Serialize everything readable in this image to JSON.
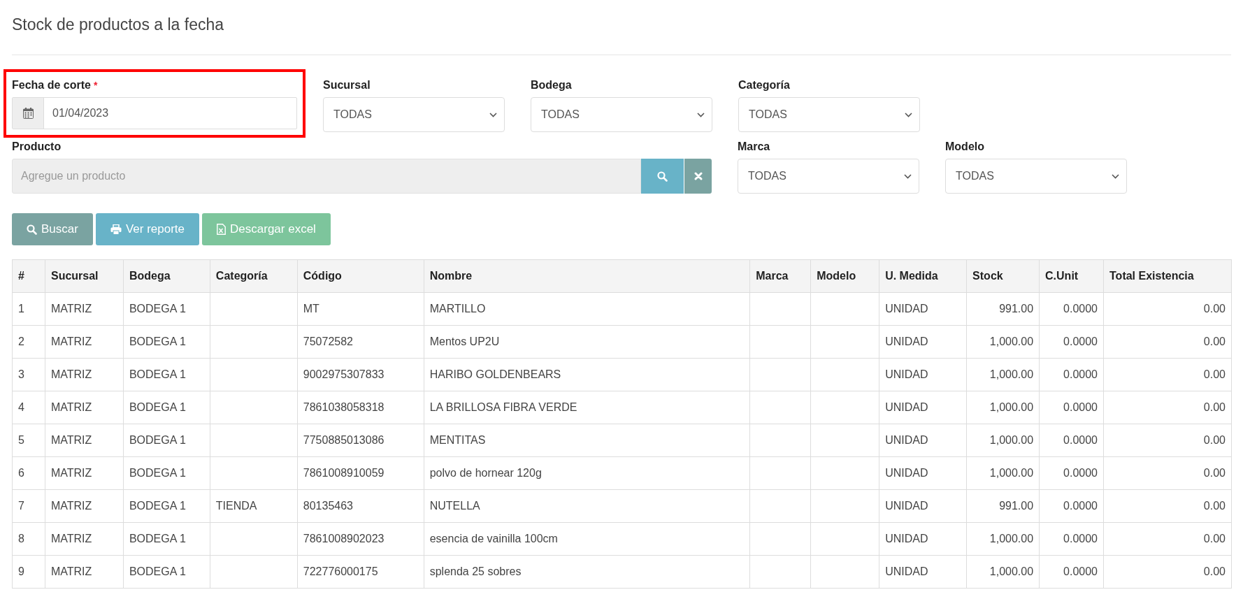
{
  "page": {
    "title": "Stock de productos a la fecha"
  },
  "filter_rows": [
    [
      {
        "kind": "date",
        "label": "Fecha de corte",
        "required_mark": "*",
        "value": "01/04/2023",
        "highlighted": true
      },
      {
        "kind": "select",
        "label": "Sucursal",
        "value": "TODAS"
      },
      {
        "kind": "select",
        "label": "Bodega",
        "value": "TODAS"
      },
      {
        "kind": "select",
        "label": "Categoría",
        "value": "TODAS"
      }
    ],
    [
      {
        "kind": "product",
        "label": "Producto",
        "placeholder": "Agregue un producto"
      },
      {
        "kind": "select",
        "label": "Marca",
        "value": "TODAS"
      },
      {
        "kind": "select",
        "label": "Modelo",
        "value": "TODAS"
      }
    ]
  ],
  "buttons": [
    {
      "kind": "search",
      "label": "Buscar"
    },
    {
      "kind": "print",
      "label": "Ver reporte"
    },
    {
      "kind": "excel",
      "label": "Descargar excel"
    }
  ],
  "table": {
    "columns": [
      {
        "label": "#",
        "kind": "text"
      },
      {
        "label": "Sucursal",
        "kind": "text"
      },
      {
        "label": "Bodega",
        "kind": "text"
      },
      {
        "label": "Categoría",
        "kind": "text"
      },
      {
        "label": "Código",
        "kind": "text"
      },
      {
        "label": "Nombre",
        "kind": "text"
      },
      {
        "label": "Marca",
        "kind": "text"
      },
      {
        "label": "Modelo",
        "kind": "text"
      },
      {
        "label": "U. Medida",
        "kind": "text"
      },
      {
        "label": "Stock",
        "kind": "number"
      },
      {
        "label": "C.Unit",
        "kind": "number"
      },
      {
        "label": "Total Existencia",
        "kind": "number"
      }
    ],
    "rows": [
      [
        "1",
        "MATRIZ",
        "BODEGA 1",
        "",
        "MT",
        "MARTILLO",
        "",
        "",
        "UNIDAD",
        "991.00",
        "0.0000",
        "0.00"
      ],
      [
        "2",
        "MATRIZ",
        "BODEGA 1",
        "",
        "75072582",
        "Mentos UP2U",
        "",
        "",
        "UNIDAD",
        "1,000.00",
        "0.0000",
        "0.00"
      ],
      [
        "3",
        "MATRIZ",
        "BODEGA 1",
        "",
        "9002975307833",
        "HARIBO GOLDENBEARS",
        "",
        "",
        "UNIDAD",
        "1,000.00",
        "0.0000",
        "0.00"
      ],
      [
        "4",
        "MATRIZ",
        "BODEGA 1",
        "",
        "7861038058318",
        "LA BRILLOSA FIBRA VERDE",
        "",
        "",
        "UNIDAD",
        "1,000.00",
        "0.0000",
        "0.00"
      ],
      [
        "5",
        "MATRIZ",
        "BODEGA 1",
        "",
        "7750885013086",
        "MENTITAS",
        "",
        "",
        "UNIDAD",
        "1,000.00",
        "0.0000",
        "0.00"
      ],
      [
        "6",
        "MATRIZ",
        "BODEGA 1",
        "",
        "7861008910059",
        "polvo de hornear 120g",
        "",
        "",
        "UNIDAD",
        "1,000.00",
        "0.0000",
        "0.00"
      ],
      [
        "7",
        "MATRIZ",
        "BODEGA 1",
        "TIENDA",
        "80135463",
        "NUTELLA",
        "",
        "",
        "UNIDAD",
        "991.00",
        "0.0000",
        "0.00"
      ],
      [
        "8",
        "MATRIZ",
        "BODEGA 1",
        "",
        "7861008902023",
        "esencia de vainilla 100cm",
        "",
        "",
        "UNIDAD",
        "1,000.00",
        "0.0000",
        "0.00"
      ],
      [
        "9",
        "MATRIZ",
        "BODEGA 1",
        "",
        "722776000175",
        "splenda 25 sobres",
        "",
        "",
        "UNIDAD",
        "1,000.00",
        "0.0000",
        "0.00"
      ]
    ]
  }
}
